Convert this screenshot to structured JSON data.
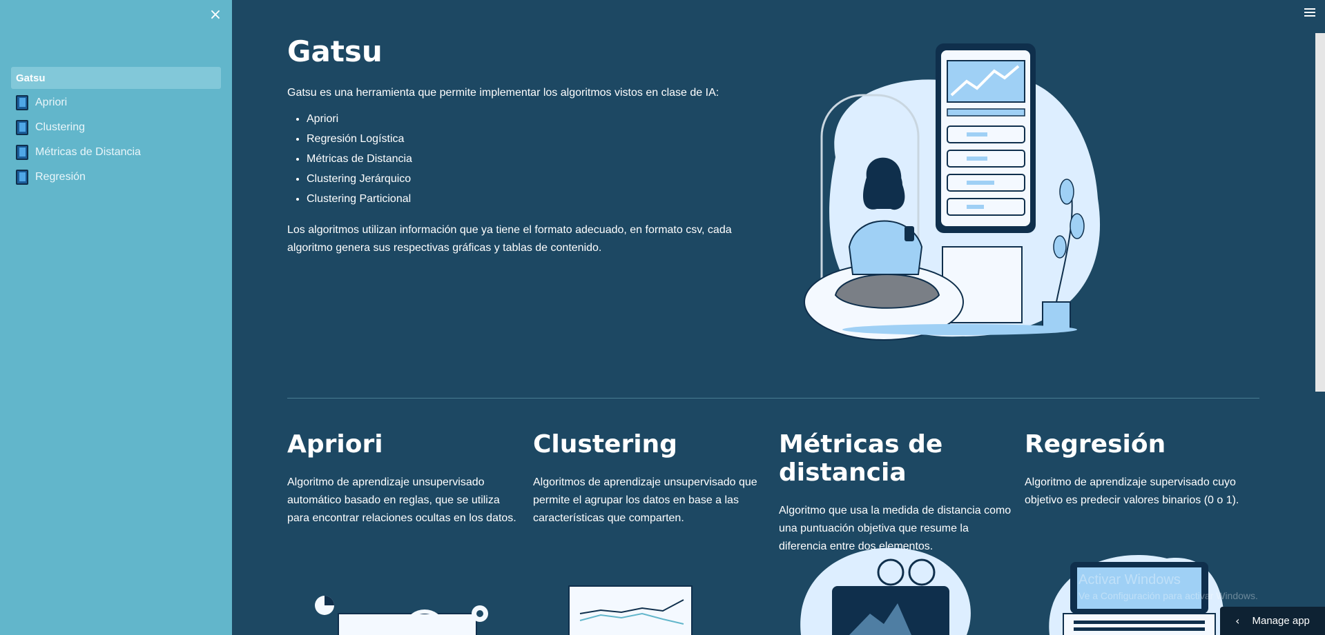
{
  "sidebar": {
    "close_icon": "×",
    "items": [
      {
        "label": "Gatsu",
        "active": true,
        "icon": null
      },
      {
        "label": "Apriori",
        "active": false,
        "icon": "book-icon"
      },
      {
        "label": "Clustering",
        "active": false,
        "icon": "book-icon"
      },
      {
        "label": "Métricas de Distancia",
        "active": false,
        "icon": "book-icon"
      },
      {
        "label": "Regresión",
        "active": false,
        "icon": "book-icon"
      }
    ]
  },
  "main": {
    "title": "Gatsu",
    "intro": "Gatsu es una herramienta que permite implementar los algoritmos vistos en clase de IA:",
    "algorithms": [
      "Apriori",
      "Regresión Logística",
      "Métricas de Distancia",
      "Clustering Jerárquico",
      "Clustering Particional"
    ],
    "outro": "Los algoritmos utilizan información que ya tiene el formato adecuado, en formato csv, cada algoritmo genera sus respectivas gráficas y tablas de contenido."
  },
  "cards": [
    {
      "title": "Apriori",
      "text": "Algoritmo de aprendizaje unsupervisado automático basado en reglas, que se utiliza para encontrar relaciones ocultas en los datos."
    },
    {
      "title": "Clustering",
      "text": "Algoritmos de aprendizaje unsupervisado que permite el agrupar los datos en base a las características que comparten."
    },
    {
      "title": "Métricas de distancia",
      "text": "Algoritmo que usa la medida de distancia como una puntuación objetiva que resume la diferencia entre dos elementos."
    },
    {
      "title": "Regresión",
      "text": "Algoritmo de aprendizaje supervisado cuyo objetivo es predecir valores binarios (0 o 1)."
    }
  ],
  "watermark": {
    "line1": "Activar Windows",
    "line2": "Ve a Configuración para activar Windows."
  },
  "footer": {
    "manage_app": "Manage app",
    "chevron": "‹"
  },
  "colors": {
    "sidebar": "#62b6cb",
    "main": "#1d4863",
    "active_item": "#82c8d9",
    "manage_app": "#0e2233"
  }
}
